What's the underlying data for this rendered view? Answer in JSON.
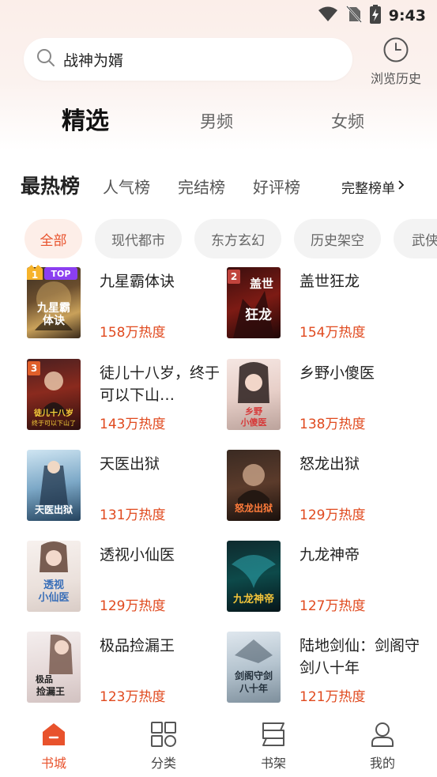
{
  "status": {
    "time": "9:43"
  },
  "search": {
    "query": "战神为婿"
  },
  "history": {
    "label": "浏览历史"
  },
  "channels": [
    {
      "label": "精选",
      "active": true
    },
    {
      "label": "男频",
      "active": false
    },
    {
      "label": "女频",
      "active": false
    }
  ],
  "rank": {
    "title": "最热榜",
    "tabs": [
      "人气榜",
      "完结榜",
      "好评榜"
    ],
    "full_list": "完整榜单"
  },
  "categories": [
    {
      "label": "全部",
      "active": true
    },
    {
      "label": "现代都市",
      "active": false
    },
    {
      "label": "东方玄幻",
      "active": false
    },
    {
      "label": "历史架空",
      "active": false
    },
    {
      "label": "武侠",
      "active": false
    }
  ],
  "books": [
    {
      "rank": "1",
      "badge": "TOP",
      "title": "九星霸体诀",
      "heat": "158万热度",
      "cover_text": "九星霸体诀"
    },
    {
      "rank": "2",
      "title": "盖世狂龙",
      "heat": "154万热度",
      "cover_text": "盖世狂龙"
    },
    {
      "rank": "3",
      "title": "徒儿十八岁，终于可以下山…",
      "heat": "143万热度",
      "cover_text": "徒儿十八岁 终于可以下山了"
    },
    {
      "rank": "",
      "title": "乡野小傻医",
      "heat": "138万热度",
      "cover_text": "乡野小傻医"
    },
    {
      "rank": "",
      "title": "天医出狱",
      "heat": "131万热度",
      "cover_text": "天医出狱"
    },
    {
      "rank": "",
      "title": "怒龙出狱",
      "heat": "129万热度",
      "cover_text": "怒龙出狱"
    },
    {
      "rank": "",
      "title": "透视小仙医",
      "heat": "129万热度",
      "cover_text": "透视小仙医"
    },
    {
      "rank": "",
      "title": "九龙神帝",
      "heat": "127万热度",
      "cover_text": "九龙神帝"
    },
    {
      "rank": "",
      "title": "极品捡漏王",
      "heat": "123万热度",
      "cover_text": "极品捡漏王"
    },
    {
      "rank": "",
      "title": "陆地剑仙：剑阁守剑八十年",
      "heat": "121万热度",
      "cover_text": "剑阁守剑八十年"
    }
  ],
  "nav": [
    {
      "label": "书城",
      "icon": "home-icon",
      "active": true
    },
    {
      "label": "分类",
      "icon": "category-grid-icon",
      "active": false
    },
    {
      "label": "书架",
      "icon": "bookshelf-icon",
      "active": false
    },
    {
      "label": "我的",
      "icon": "profile-icon",
      "active": false
    }
  ],
  "colors": {
    "accent": "#e8522c",
    "heat": "#e04a1f"
  }
}
